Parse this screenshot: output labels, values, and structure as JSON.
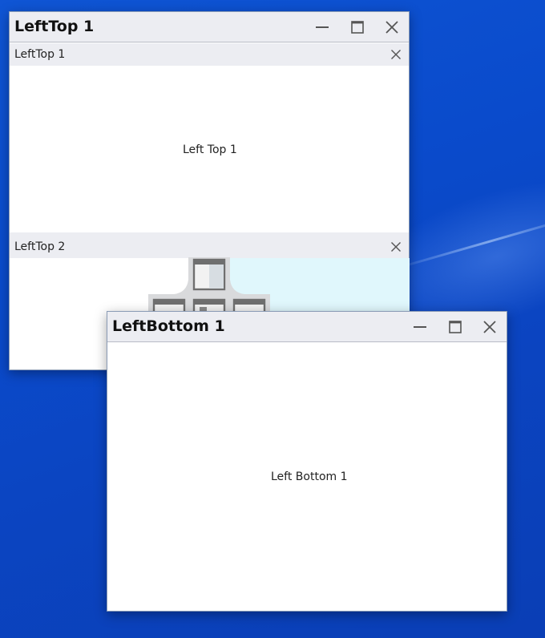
{
  "windows": {
    "left_top": {
      "title": "LeftTop 1",
      "panes": [
        {
          "header": "LeftTop 1",
          "content": "Left Top 1"
        },
        {
          "header": "LeftTop 2",
          "content": ""
        }
      ]
    },
    "left_bottom": {
      "title": "LeftBottom 1",
      "content": "Left Bottom 1"
    }
  },
  "colors": {
    "desktop": "#0b4ac9",
    "titlebar": "#ecedf2",
    "dock_preview": "#e0f7fc",
    "dock_guide": "#d9dadc"
  },
  "icons": {
    "minimize": "minimize-icon",
    "maximize": "maximize-icon",
    "close": "close-icon",
    "dock_compass": "dock-compass-icon"
  }
}
